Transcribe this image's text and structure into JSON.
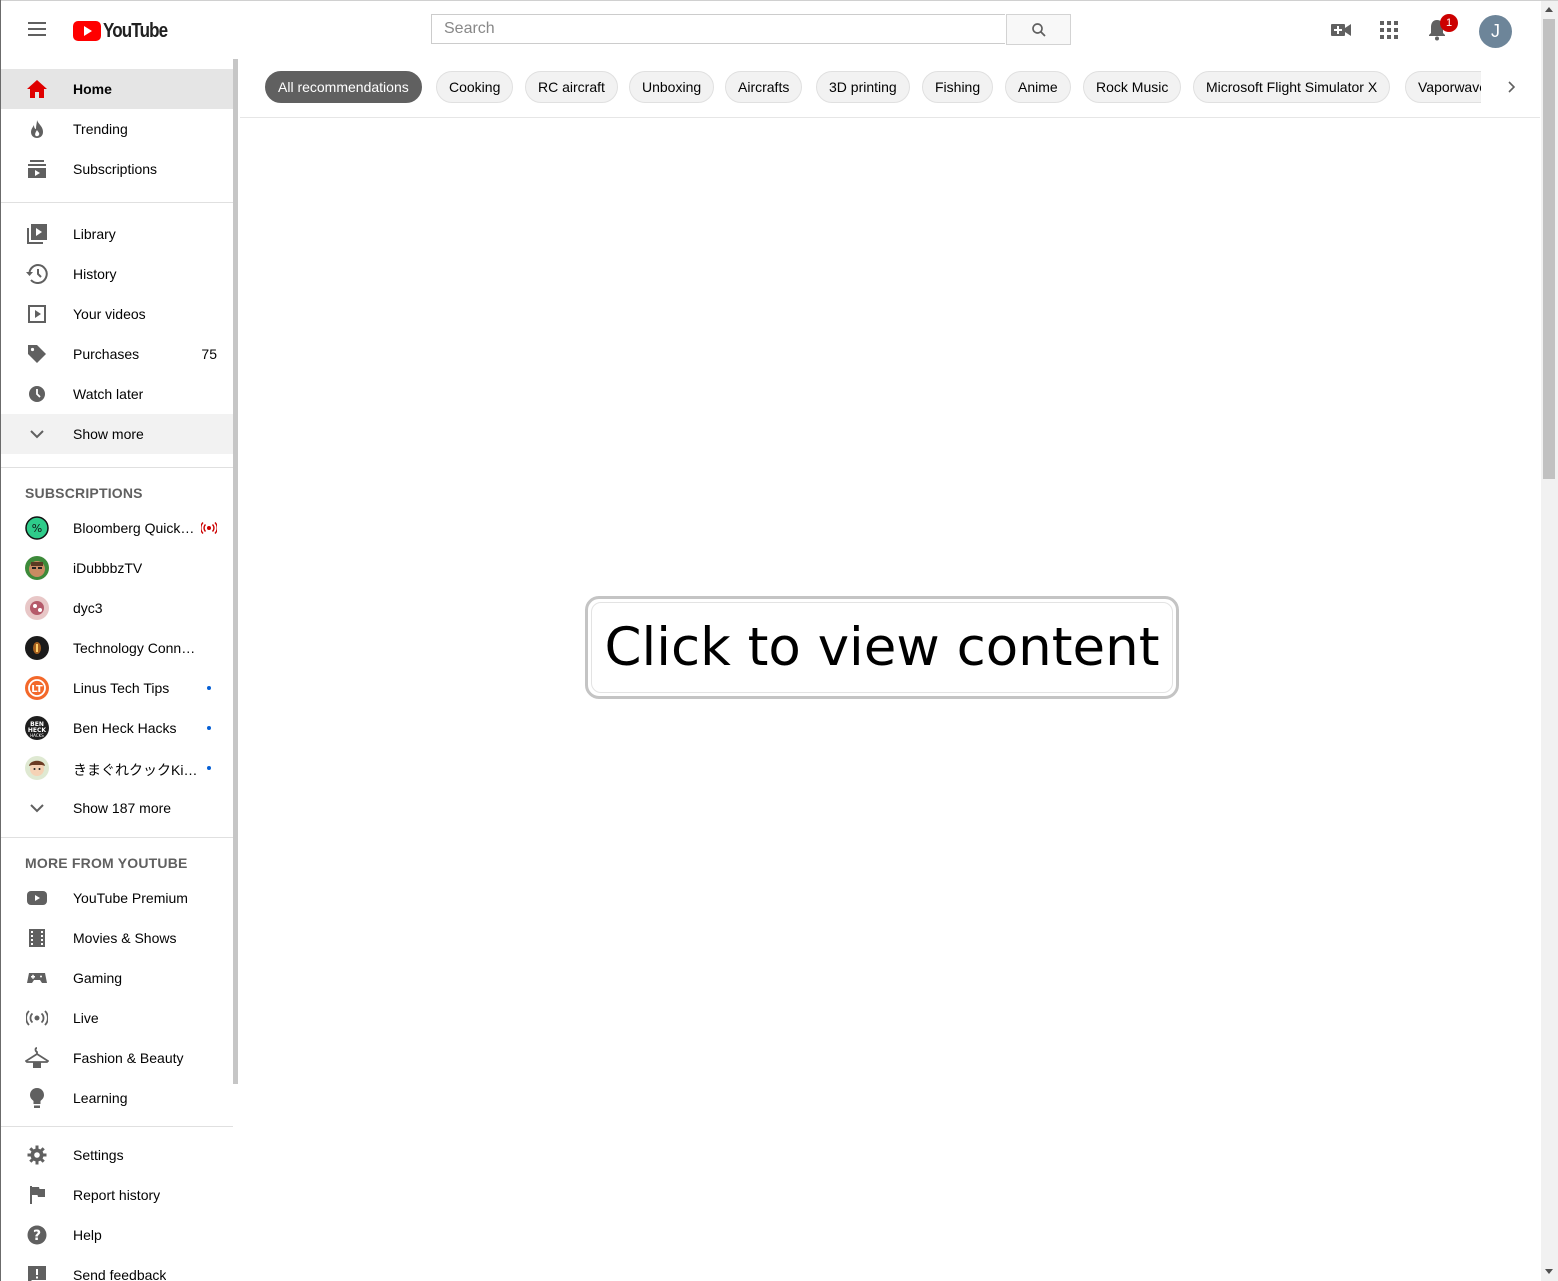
{
  "header": {
    "logo_text": "YouTube",
    "search_placeholder": "Search",
    "notification_count": "1",
    "avatar_letter": "J"
  },
  "sidebar": {
    "main": [
      {
        "label": "Home",
        "icon": "home-icon"
      },
      {
        "label": "Trending",
        "icon": "trending-icon"
      },
      {
        "label": "Subscriptions",
        "icon": "subscriptions-icon"
      }
    ],
    "library": [
      {
        "label": "Library",
        "icon": "library-icon"
      },
      {
        "label": "History",
        "icon": "history-icon"
      },
      {
        "label": "Your videos",
        "icon": "your-videos-icon"
      },
      {
        "label": "Purchases",
        "icon": "purchases-icon",
        "count": "75"
      },
      {
        "label": "Watch later",
        "icon": "watch-later-icon"
      },
      {
        "label": "Show more",
        "icon": "chevron-down-icon"
      }
    ],
    "subscriptions_title": "SUBSCRIPTIONS",
    "subscriptions": [
      {
        "label": "Bloomberg QuickT…",
        "status": "live"
      },
      {
        "label": "iDubbbzTV",
        "status": ""
      },
      {
        "label": "dyc3",
        "status": ""
      },
      {
        "label": "Technology Connecti…",
        "status": ""
      },
      {
        "label": "Linus Tech Tips",
        "status": "new"
      },
      {
        "label": "Ben Heck Hacks",
        "status": "new"
      },
      {
        "label": "きまぐれクックKi…",
        "status": "new"
      }
    ],
    "show_more_subs": "Show 187 more",
    "more_title": "MORE FROM YOUTUBE",
    "more": [
      {
        "label": "YouTube Premium",
        "icon": "youtube-premium-icon"
      },
      {
        "label": "Movies & Shows",
        "icon": "movies-icon"
      },
      {
        "label": "Gaming",
        "icon": "gaming-icon"
      },
      {
        "label": "Live",
        "icon": "live-icon"
      },
      {
        "label": "Fashion & Beauty",
        "icon": "fashion-icon"
      },
      {
        "label": "Learning",
        "icon": "learning-icon"
      }
    ],
    "footer": [
      {
        "label": "Settings",
        "icon": "gear-icon"
      },
      {
        "label": "Report history",
        "icon": "flag-icon"
      },
      {
        "label": "Help",
        "icon": "help-icon"
      },
      {
        "label": "Send feedback",
        "icon": "feedback-icon"
      }
    ]
  },
  "chips": [
    "All recommendations",
    "Cooking",
    "RC aircraft",
    "Unboxing",
    "Aircrafts",
    "3D printing",
    "Fishing",
    "Anime",
    "Rock Music",
    "Microsoft Flight Simulator X",
    "Vaporwave"
  ],
  "content": {
    "click_to_view": "Click to view content"
  }
}
